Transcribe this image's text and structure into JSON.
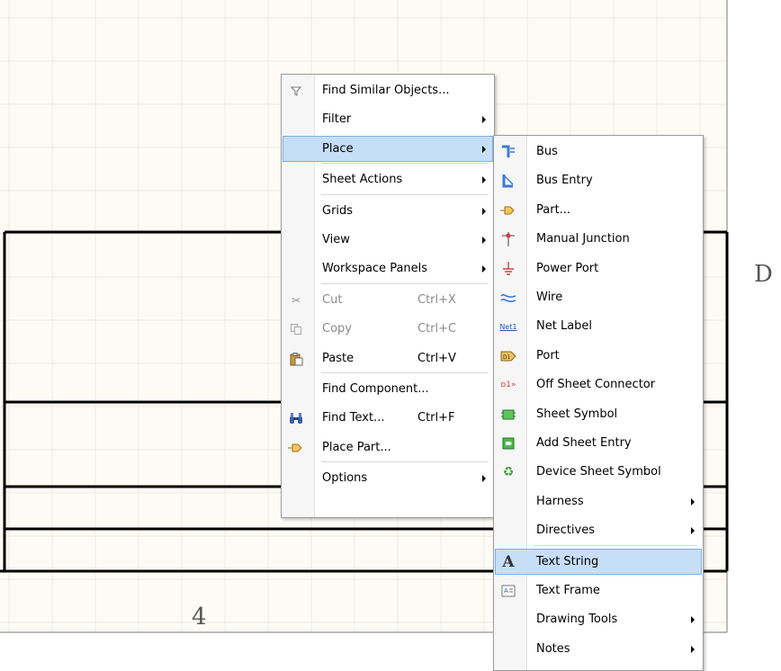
{
  "sheet": {
    "zone_row_label": "D",
    "zone_col_label": "4"
  },
  "context_menu": {
    "items": [
      {
        "label": "Find Similar Objects...",
        "icon": "filter-funnel-icon",
        "shortcut": "",
        "submenu": false,
        "disabled": false
      },
      {
        "label": "Filter",
        "icon": "",
        "shortcut": "",
        "submenu": true,
        "disabled": false
      },
      {
        "label": "Place",
        "icon": "",
        "shortcut": "",
        "submenu": true,
        "disabled": false,
        "highlighted": true
      },
      {
        "label": "Sheet Actions",
        "icon": "",
        "shortcut": "",
        "submenu": true,
        "disabled": false
      },
      {
        "label": "Grids",
        "icon": "",
        "shortcut": "",
        "submenu": true,
        "disabled": false
      },
      {
        "label": "View",
        "icon": "",
        "shortcut": "",
        "submenu": true,
        "disabled": false
      },
      {
        "label": "Workspace Panels",
        "icon": "",
        "shortcut": "",
        "submenu": true,
        "disabled": false
      },
      {
        "label": "Cut",
        "icon": "scissors-icon",
        "shortcut": "Ctrl+X",
        "submenu": false,
        "disabled": true
      },
      {
        "label": "Copy",
        "icon": "copy-icon",
        "shortcut": "Ctrl+C",
        "submenu": false,
        "disabled": true
      },
      {
        "label": "Paste",
        "icon": "paste-icon",
        "shortcut": "Ctrl+V",
        "submenu": false,
        "disabled": false
      },
      {
        "label": "Find Component...",
        "icon": "",
        "shortcut": "",
        "submenu": false,
        "disabled": false
      },
      {
        "label": "Find Text...",
        "icon": "binoculars-icon",
        "shortcut": "Ctrl+F",
        "submenu": false,
        "disabled": false
      },
      {
        "label": "Place Part...",
        "icon": "part-icon",
        "shortcut": "",
        "submenu": false,
        "disabled": false
      },
      {
        "label": "Options",
        "icon": "",
        "shortcut": "",
        "submenu": true,
        "disabled": false
      }
    ]
  },
  "place_submenu": {
    "items": [
      {
        "label": "Bus",
        "icon": "bus-icon",
        "submenu": false
      },
      {
        "label": "Bus Entry",
        "icon": "bus-entry-icon",
        "submenu": false
      },
      {
        "label": "Part...",
        "icon": "part-icon",
        "submenu": false
      },
      {
        "label": "Manual Junction",
        "icon": "junction-icon",
        "submenu": false
      },
      {
        "label": "Power Port",
        "icon": "power-port-icon",
        "submenu": false
      },
      {
        "label": "Wire",
        "icon": "wire-icon",
        "submenu": false
      },
      {
        "label": "Net Label",
        "icon": "net-label-icon",
        "icon_text": "Net1",
        "submenu": false
      },
      {
        "label": "Port",
        "icon": "port-icon",
        "submenu": false
      },
      {
        "label": "Off Sheet Connector",
        "icon": "off-sheet-connector-icon",
        "submenu": false
      },
      {
        "label": "Sheet Symbol",
        "icon": "sheet-symbol-icon",
        "submenu": false
      },
      {
        "label": "Add Sheet Entry",
        "icon": "sheet-entry-icon",
        "submenu": false
      },
      {
        "label": "Device Sheet Symbol",
        "icon": "device-sheet-symbol-icon",
        "submenu": false
      },
      {
        "label": "Harness",
        "icon": "",
        "submenu": true
      },
      {
        "label": "Directives",
        "icon": "",
        "submenu": true
      },
      {
        "label": "Text String",
        "icon": "text-string-icon",
        "icon_text": "A",
        "submenu": false,
        "highlighted": true
      },
      {
        "label": "Text Frame",
        "icon": "text-frame-icon",
        "submenu": false
      },
      {
        "label": "Drawing Tools",
        "icon": "",
        "submenu": true
      },
      {
        "label": "Notes",
        "icon": "",
        "submenu": true
      }
    ]
  },
  "colors": {
    "sheet_bg": "#fdfbf4",
    "grid": "#ecebe3",
    "highlight": "#c6def6",
    "highlight_border": "#7ab0e6"
  }
}
